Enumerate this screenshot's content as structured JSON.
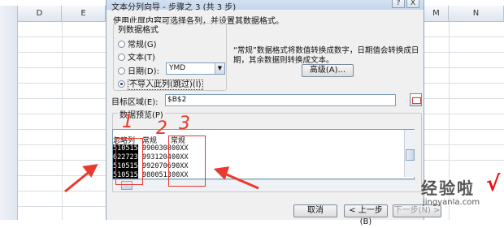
{
  "spreadsheet": {
    "columns": [
      "D",
      "E",
      "M",
      "N"
    ]
  },
  "dialog": {
    "title": "文本分列向导 - 步骤之 3 (共 3 步)",
    "help_label": "?",
    "close_label": "X",
    "instruction": "使用此屏内容可选择各列，并设置其数据格式。",
    "column_format": {
      "legend": "列数据格式",
      "options": [
        {
          "label": "常规(G)",
          "selected": false
        },
        {
          "label": "文本(T)",
          "selected": false
        },
        {
          "label": "日期(D):",
          "selected": false
        },
        {
          "label": "不导入此列(跳过)(I)",
          "selected": true
        }
      ],
      "date_format_value": "YMD"
    },
    "description": "“常规”数据格式将数值转换成数字，日期值会转换成日期，其余数据则转换成文本。",
    "advanced_button": "高级(A)...",
    "target": {
      "label": "目标区域(E):",
      "value": "$B$2"
    },
    "preview": {
      "label": "数据预览(P)",
      "headers": [
        "忽略列",
        "常规",
        "常规"
      ],
      "rows": [
        [
          "510515",
          "9900308",
          "00XX"
        ],
        [
          "622723",
          "9931204",
          "00XX"
        ],
        [
          "510515",
          "9920706",
          "90XX"
        ],
        [
          "510515",
          "9800513",
          "00XX"
        ]
      ]
    },
    "buttons": {
      "cancel": "取消",
      "back": "< 上一步(B)",
      "next": "下一步(N) >"
    }
  },
  "annotations": {
    "numbers": [
      "1",
      "2",
      "3"
    ],
    "color": "#e83a2e"
  },
  "watermark": {
    "text": "经验啦",
    "check": "√",
    "url": "jingyanla.com"
  }
}
